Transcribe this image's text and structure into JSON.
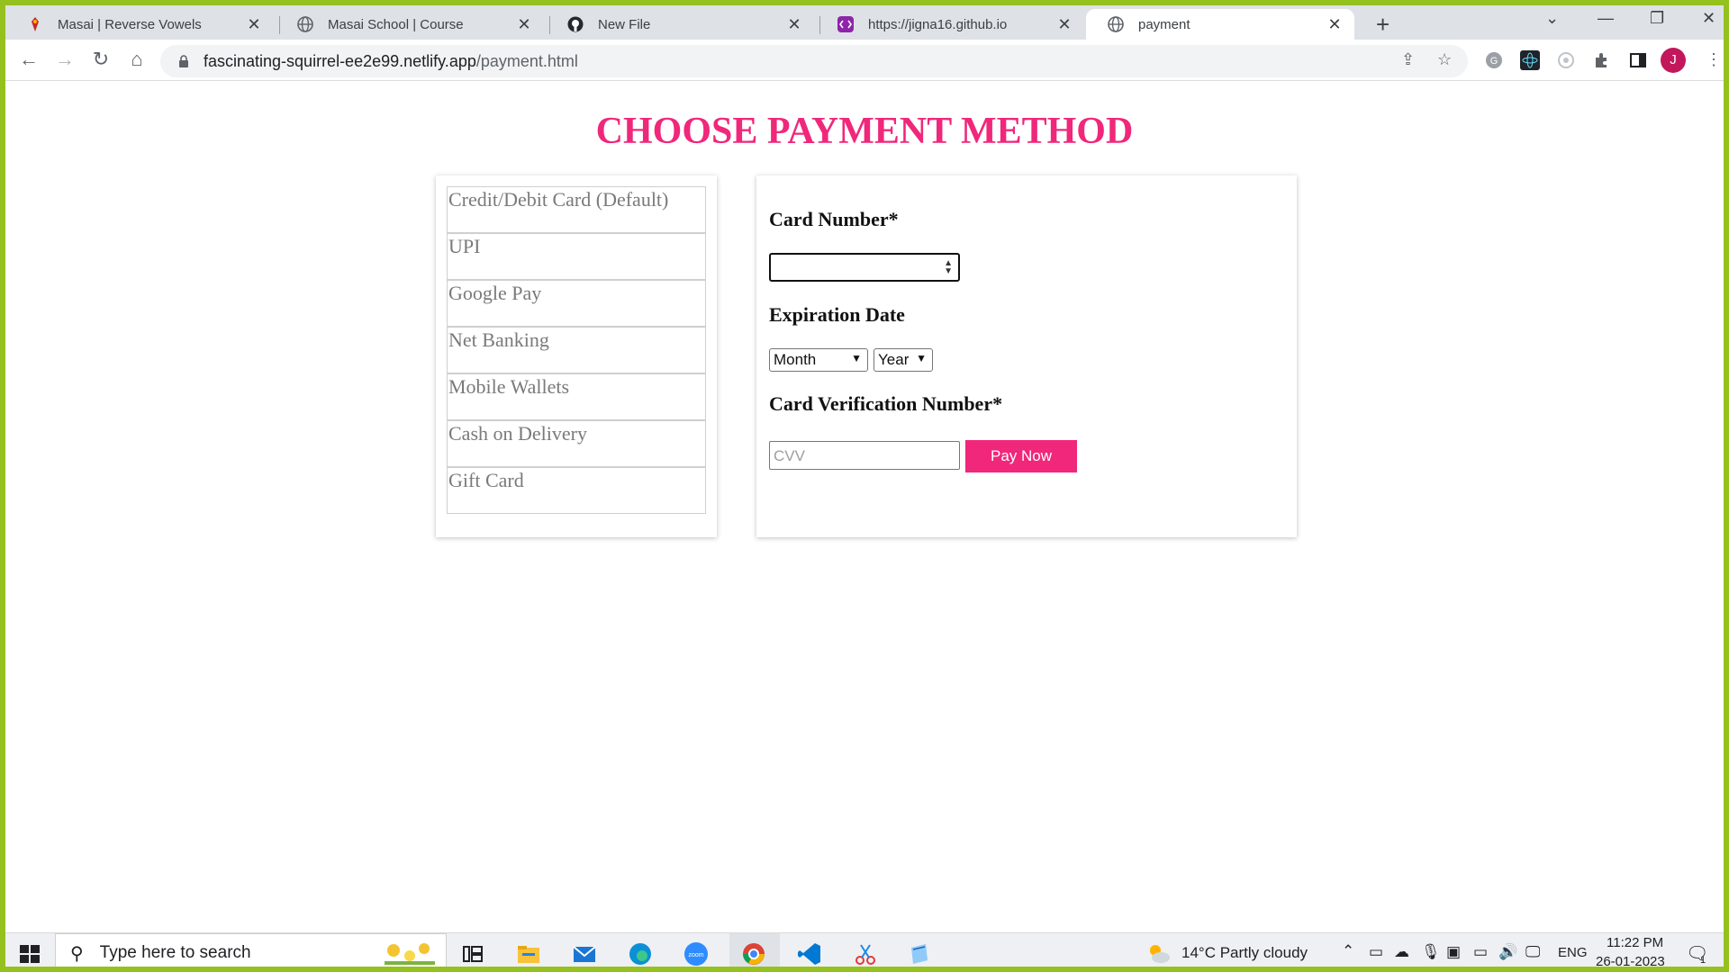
{
  "browser": {
    "tabs": [
      {
        "title": "Masai | Reverse Vowels",
        "icon": "masai-favicon"
      },
      {
        "title": "Masai School | Course",
        "icon": "globe-icon"
      },
      {
        "title": "New File",
        "icon": "github-icon"
      },
      {
        "title": "https://jigna16.github.io",
        "icon": "code-favicon"
      },
      {
        "title": "payment",
        "icon": "globe-icon",
        "active": true
      }
    ],
    "url_host": "fascinating-squirrel-ee2e99.netlify.app",
    "url_path": "/payment.html",
    "profile_initial": "J"
  },
  "page": {
    "title": "CHOOSE PAYMENT METHOD",
    "methods": [
      "Credit/Debit Card (Default)",
      "UPI",
      "Google Pay",
      "Net Banking",
      "Mobile Wallets",
      "Cash on Delivery",
      "Gift Card"
    ],
    "form": {
      "card_number_label": "Card Number*",
      "card_number_value": "",
      "expiration_label": "Expiration Date",
      "month_selected": "Month",
      "year_selected": "Year",
      "cvv_label": "Card Verification Number*",
      "cvv_placeholder": "CVV",
      "pay_button": "Pay Now"
    },
    "accent_color": "#f0277a"
  },
  "taskbar": {
    "search_placeholder": "Type here to search",
    "weather": "14°C  Partly cloudy",
    "language": "ENG",
    "time": "11:22 PM",
    "date": "26-01-2023",
    "notification_count": "1"
  }
}
